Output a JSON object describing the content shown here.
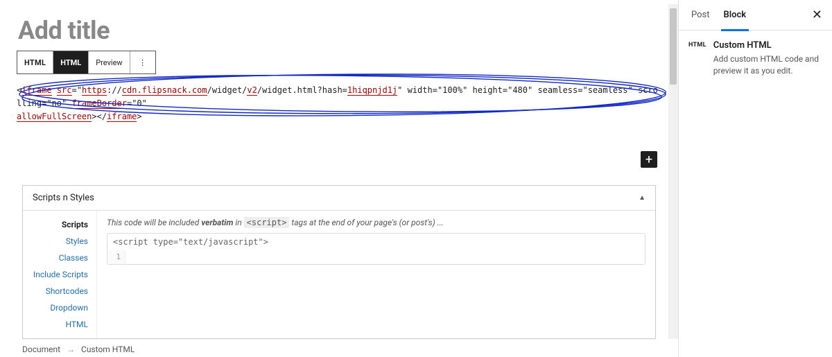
{
  "editor": {
    "title_placeholder": "Add title",
    "toolbar": {
      "icon_label": "HTML",
      "html_label": "HTML",
      "preview_label": "Preview",
      "more_glyph": "⋮"
    },
    "html_block": {
      "tokens": {
        "iframe_open": "iframe",
        "src_attr": "src",
        "https": "https",
        "domain": "cdn.flipsnack.com",
        "path_seg1": "/widget/",
        "v2": "v2",
        "path_seg2": "/widget.html?hash=",
        "hash": "1hiqpnjd1j",
        "attrs_rest": "\" width=\"100%\" height=\"480\" seamless=\"seamless\" scrolling=\"no\" ",
        "frameborder": "frameBorder",
        "frameborder_val": "=\"0\" ",
        "allowfs": "allowFullScreen",
        "close1": "></",
        "iframe_close": "iframe",
        "close2": ">"
      }
    },
    "add_block_glyph": "+"
  },
  "scripts_panel": {
    "title": "Scripts n Styles",
    "collapse_glyph": "▲",
    "tabs": [
      "Scripts",
      "Styles",
      "Classes",
      "Include Scripts",
      "Shortcodes",
      "Dropdown",
      "HTML"
    ],
    "active_tab_index": 0,
    "note_pre": "This code will be included ",
    "note_strong": "verbatim",
    "note_mid": " in ",
    "note_code": "<script>",
    "note_post": " tags at the end of your page's (or post's) ...",
    "editor": {
      "head": "<script type=\"text/javascript\">",
      "line_number": "1",
      "line_content": ""
    }
  },
  "breadcrumb": {
    "root": "Document",
    "sep": "→",
    "current": "Custom HTML"
  },
  "sidebar": {
    "tabs": {
      "post": "Post",
      "block": "Block"
    },
    "close_glyph": "✕",
    "block": {
      "icon_label": "HTML",
      "title": "Custom HTML",
      "desc": "Add custom HTML code and preview it as you edit."
    }
  },
  "annotation": {
    "color": "#1128c4"
  }
}
